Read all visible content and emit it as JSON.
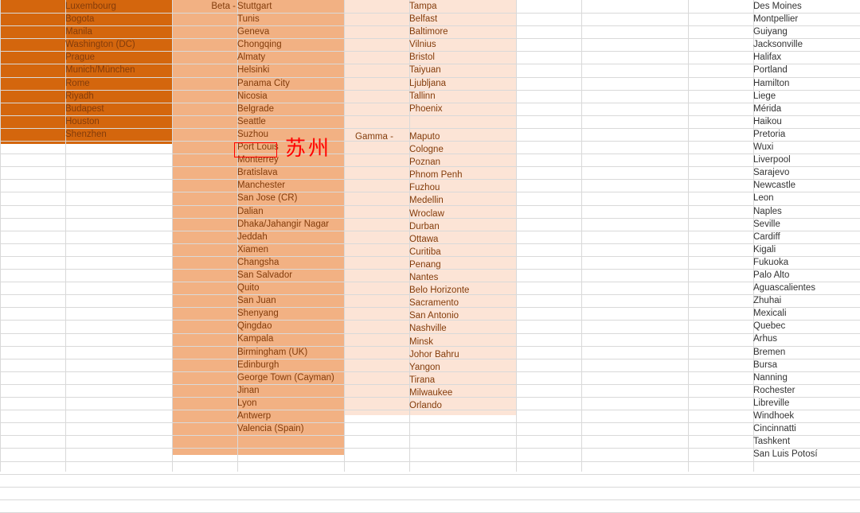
{
  "spreadsheet": {
    "columns": {
      "alpha_minus": {
        "band_color": "#d4660d",
        "text_color": "#843c0b",
        "cities": [
          "Luxembourg",
          "Bogota",
          "Manila",
          "Washington (DC)",
          "Prague",
          "Munich/München",
          "Rome",
          "Riyadh",
          "Budapest",
          "Houston",
          "Shenzhen"
        ]
      },
      "beta": {
        "band_color": "#f2b183",
        "text_color": "#833c0b",
        "tier_label": "Beta -",
        "cities": [
          "Stuttgart",
          "Tunis",
          "Geneva",
          "Chongqing",
          "Almaty",
          "Helsinki",
          "Panama City",
          "Nicosia",
          "Belgrade",
          "Seattle",
          "Suzhou",
          "Port Louis",
          "Monterrey",
          "Bratislava",
          "Manchester",
          "San Jose (CR)",
          "Dalian",
          "Dhaka/Jahangir Nagar",
          "Jeddah",
          "Xiamen",
          "Changsha",
          "San Salvador",
          "Quito",
          "San Juan",
          "Shenyang",
          "Qingdao",
          "Kampala",
          "Birmingham (UK)",
          "Edinburgh",
          "George Town (Cayman)",
          "Jinan",
          "Lyon",
          "Antwerp",
          "Valencia (Spain)"
        ]
      },
      "gamma": {
        "band_color": "#fce4d6",
        "text_color": "#833c0b",
        "tier_label": "Gamma -",
        "cities_upper": [
          "Tampa",
          "Belfast",
          "Baltimore",
          "Vilnius",
          "Bristol",
          "Taiyuan",
          "Ljubljana",
          "Tallinn",
          "Phoenix"
        ],
        "cities_lower": [
          "Maputo",
          "Cologne",
          "Poznan",
          "Phnom Penh",
          "Fuzhou",
          "Medellin",
          "Wroclaw",
          "Durban",
          "Ottawa",
          "Curitiba",
          "Penang",
          "Nantes",
          "Belo Horizonte",
          "Sacramento",
          "San Antonio",
          "Nashville",
          "Minsk",
          "Johor Bahru",
          "Yangon",
          "Tirana",
          "Milwaukee",
          "Orlando"
        ]
      },
      "sufficiency": {
        "band_color": "#ffffff",
        "text_color": "#333333",
        "cities": [
          "Des Moines",
          "Montpellier",
          "Guiyang",
          "Jacksonville",
          "Halifax",
          "Portland",
          "Hamilton",
          "Liege",
          "Mérida",
          "Haikou",
          "Pretoria",
          "Wuxi",
          "Liverpool",
          "Sarajevo",
          "Newcastle",
          "Leon",
          "Naples",
          "Seville",
          "Cardiff",
          "Kigali",
          "Fukuoka",
          "Palo Alto",
          "Aguascalientes",
          "Zhuhai",
          "Mexicali",
          "Quebec",
          "Arhus",
          "Bremen",
          "Bursa",
          "Nanning",
          "Rochester",
          "Libreville",
          "Windhoek",
          "Cincinnatti",
          "Tashkent",
          "San Luis Potosí"
        ]
      }
    },
    "annotation": {
      "highlighted_cell": "Suzhou",
      "chinese_label": "苏州",
      "highlight_color": "#ff0000"
    }
  }
}
